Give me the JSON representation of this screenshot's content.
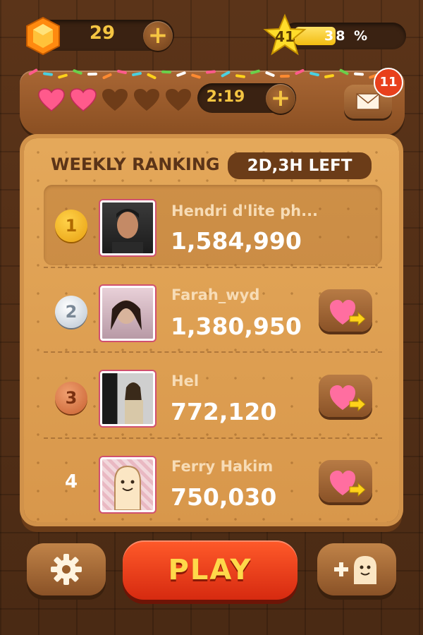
{
  "top_bar": {
    "gems": "29",
    "level": "41",
    "xp_percent": "38 %",
    "xp_fraction": 0.38
  },
  "header": {
    "hearts_full": 2,
    "hearts_total": 5,
    "timer": "2:19",
    "mail_badge": "11"
  },
  "ranking": {
    "title": "WEEKLY RANKING",
    "time_left": "2D,3H LEFT",
    "players": [
      {
        "rank": "1",
        "name": "Hendri d'lite ph...",
        "score": "1,584,990"
      },
      {
        "rank": "2",
        "name": "Farah_wyd",
        "score": "1,380,950"
      },
      {
        "rank": "3",
        "name": "Hel",
        "score": "772,120"
      },
      {
        "rank": "4",
        "name": "Ferry Hakim",
        "score": "750,030"
      }
    ]
  },
  "bottom": {
    "play_label": "PLAY"
  },
  "colors": {
    "accent_yellow": "#f5c542",
    "heart_pink": "#ff5a8c",
    "play_red": "#e8401c"
  }
}
